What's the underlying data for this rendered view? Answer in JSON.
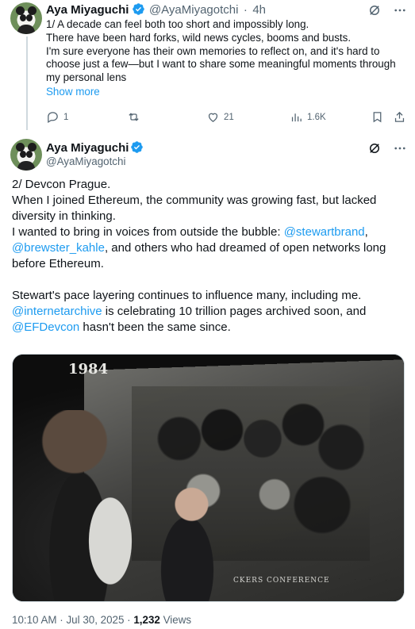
{
  "tweet1": {
    "author_name": "Aya Miyaguchi",
    "handle": "@AyaMiyagotchi",
    "separator": "·",
    "time": "4h",
    "lines": [
      "1/ A decade can feel both too short and impossibly long.",
      "There have been hard forks, wild news cycles, booms and busts.",
      "I'm sure everyone has their own memories to reflect on, and it's hard to",
      "choose just a few—but I want to share some meaningful moments through",
      "my personal lens"
    ],
    "show_more": "Show more",
    "replies": "1",
    "likes": "21",
    "views": "1.6K"
  },
  "tweet2": {
    "author_name": "Aya Miyaguchi",
    "handle": "@AyaMiyagotchi",
    "line1": "2/ Devcon Prague.",
    "line2a": "When I joined Ethereum, the community was growing fast, but lacked",
    "line2b": "diversity in thinking.",
    "line3a": "I wanted to bring in voices from outside the bubble: ",
    "mention1": "@stewartbrand",
    "mention1_after": ",",
    "mention2": "@brewster_kahle",
    "line3b": ", and others who had dreamed of open networks long",
    "line3c": "before Ethereum.",
    "line4": "Stewart's pace layering continues to influence many, including me.",
    "mention3": "@internetarchive",
    "line5a": " is celebrating 10 trillion pages archived soon, and",
    "mention4": "@EFDevcon",
    "line5b": " hasn't been the same since.",
    "image": {
      "year_text": "1984",
      "banner_text": "CKERS CONFERENCE"
    },
    "timestamp": "10:10 AM · Jul 30, 2025 · ",
    "views_count": "1,232",
    "views_label": " Views"
  },
  "colors": {
    "accent": "#1d9bf0",
    "text": "#0f1419",
    "secondary": "#536471"
  }
}
